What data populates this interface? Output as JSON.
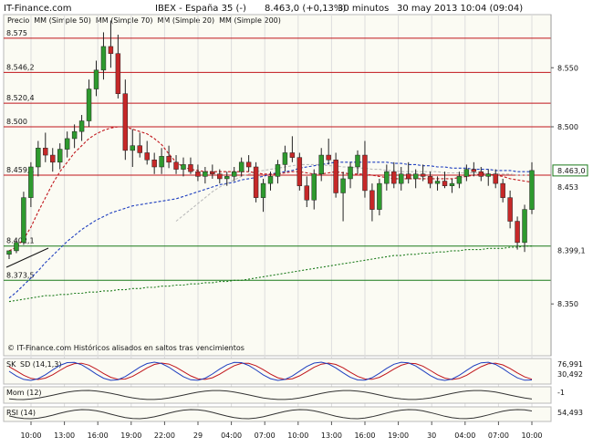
{
  "header": {
    "brand": "IT-Finance.com",
    "instrument": "IBEX - España 35 (-)",
    "quote": "8.463,0 (+0,13%)",
    "interval": "30 minutos",
    "datetime": "30 may 2013 10:04 (09:04)"
  },
  "legend": [
    {
      "text": "Precio",
      "color": "#222222"
    },
    {
      "text": "MM (Simple 50)",
      "color": "#bbbbbb"
    },
    {
      "text": "MM (Simple 70)",
      "color": "#1f3fbf"
    },
    {
      "text": "MM (Simple 20)",
      "color": "#c0151b"
    },
    {
      "text": "MM (Simple 200)",
      "color": "#1a7a1a"
    }
  ],
  "footer_note": "© IT-Finance.com  Históricos alisados en saltos tras vencimientos",
  "chart_data": {
    "type": "candlestick",
    "y_range": [
      8.32,
      8.595
    ],
    "right_ticks": [
      "8.550",
      "8.500",
      "8.350"
    ],
    "right_tick_values": [
      8.55,
      8.5,
      8.35
    ],
    "price_labels": [
      {
        "text": "8.463,0",
        "value": 8.463,
        "color": "#1a7a1a",
        "boxed": true
      },
      {
        "text": "8.453",
        "value": 8.453,
        "color": "#c0151b",
        "boxed": false
      },
      {
        "text": "8.399,1",
        "value": 8.399,
        "color": "#1a7a1a",
        "boxed": false
      }
    ],
    "levels": [
      {
        "text": "8.575",
        "value": 8.575,
        "color": "#c0151b"
      },
      {
        "text": "8.546,2",
        "value": 8.546,
        "color": "#c0151b"
      },
      {
        "text": "8.520,4",
        "value": 8.52,
        "color": "#c0151b"
      },
      {
        "text": "8.500",
        "value": 8.5,
        "color": "#c0151b"
      },
      {
        "text": "8.459,1",
        "value": 8.459,
        "color": "#c0151b"
      },
      {
        "text": "8.402,1",
        "value": 8.399,
        "color": "#1a7a1a"
      },
      {
        "text": "8.373,5",
        "value": 8.37,
        "color": "#1a7a1a"
      }
    ],
    "x_labels": [
      "10:00",
      "13:00",
      "16:00",
      "19:00",
      "22:00",
      "29",
      "04:00",
      "07:00",
      "10:00",
      "13:00",
      "16:00",
      "19:00",
      "30",
      "04:00",
      "07:00",
      "10:00"
    ],
    "candles": [
      [
        8.392,
        8.395,
        8.388,
        8.395
      ],
      [
        8.395,
        8.405,
        8.393,
        8.402
      ],
      [
        8.402,
        8.445,
        8.4,
        8.44
      ],
      [
        8.44,
        8.47,
        8.432,
        8.466
      ],
      [
        8.466,
        8.488,
        8.458,
        8.482
      ],
      [
        8.482,
        8.495,
        8.47,
        8.476
      ],
      [
        8.476,
        8.482,
        8.462,
        8.47
      ],
      [
        8.47,
        8.486,
        8.464,
        8.481
      ],
      [
        8.481,
        8.496,
        8.474,
        8.49
      ],
      [
        8.49,
        8.502,
        8.482,
        8.496
      ],
      [
        8.496,
        8.51,
        8.488,
        8.505
      ],
      [
        8.505,
        8.54,
        8.5,
        8.532
      ],
      [
        8.532,
        8.556,
        8.526,
        8.548
      ],
      [
        8.548,
        8.58,
        8.54,
        8.568
      ],
      [
        8.568,
        8.59,
        8.55,
        8.562
      ],
      [
        8.562,
        8.578,
        8.524,
        8.528
      ],
      [
        8.528,
        8.54,
        8.472,
        8.48
      ],
      [
        8.48,
        8.498,
        8.466,
        8.484
      ],
      [
        8.484,
        8.495,
        8.474,
        8.478
      ],
      [
        8.478,
        8.488,
        8.468,
        8.472
      ],
      [
        8.472,
        8.478,
        8.46,
        8.466
      ],
      [
        8.466,
        8.482,
        8.46,
        8.475
      ],
      [
        8.475,
        8.484,
        8.465,
        8.47
      ],
      [
        8.47,
        8.476,
        8.46,
        8.464
      ],
      [
        8.464,
        8.474,
        8.458,
        8.468
      ],
      [
        8.468,
        8.474,
        8.46,
        8.462
      ],
      [
        8.462,
        8.468,
        8.454,
        8.458
      ],
      [
        8.458,
        8.466,
        8.452,
        8.462
      ],
      [
        8.462,
        8.468,
        8.456,
        8.46
      ],
      [
        8.46,
        8.464,
        8.452,
        8.456
      ],
      [
        8.456,
        8.462,
        8.45,
        8.458
      ],
      [
        8.458,
        8.466,
        8.454,
        8.462
      ],
      [
        8.462,
        8.474,
        8.458,
        8.47
      ],
      [
        8.47,
        8.476,
        8.462,
        8.466
      ],
      [
        8.466,
        8.47,
        8.436,
        8.44
      ],
      [
        8.44,
        8.456,
        8.428,
        8.452
      ],
      [
        8.452,
        8.462,
        8.446,
        8.458
      ],
      [
        8.458,
        8.472,
        8.452,
        8.468
      ],
      [
        8.468,
        8.484,
        8.462,
        8.478
      ],
      [
        8.478,
        8.492,
        8.47,
        8.474
      ],
      [
        8.474,
        8.478,
        8.446,
        8.45
      ],
      [
        8.45,
        8.458,
        8.432,
        8.438
      ],
      [
        8.438,
        8.464,
        8.43,
        8.46
      ],
      [
        8.46,
        8.482,
        8.454,
        8.476
      ],
      [
        8.476,
        8.49,
        8.468,
        8.472
      ],
      [
        8.472,
        8.478,
        8.44,
        8.444
      ],
      [
        8.444,
        8.462,
        8.42,
        8.456
      ],
      [
        8.456,
        8.47,
        8.448,
        8.466
      ],
      [
        8.466,
        8.48,
        8.46,
        8.476
      ],
      [
        8.476,
        8.488,
        8.44,
        8.446
      ],
      [
        8.446,
        8.452,
        8.42,
        8.43
      ],
      [
        8.43,
        8.456,
        8.425,
        8.452
      ],
      [
        8.452,
        8.468,
        8.446,
        8.462
      ],
      [
        8.462,
        8.47,
        8.448,
        8.452
      ],
      [
        8.452,
        8.466,
        8.446,
        8.46
      ],
      [
        8.46,
        8.47,
        8.452,
        8.456
      ],
      [
        8.456,
        8.464,
        8.448,
        8.46
      ],
      [
        8.46,
        8.468,
        8.454,
        8.458
      ],
      [
        8.458,
        8.462,
        8.448,
        8.452
      ],
      [
        8.452,
        8.458,
        8.446,
        8.454
      ],
      [
        8.454,
        8.462,
        8.448,
        8.45
      ],
      [
        8.45,
        8.456,
        8.444,
        8.452
      ],
      [
        8.452,
        8.462,
        8.448,
        8.458
      ],
      [
        8.458,
        8.468,
        8.454,
        8.464
      ],
      [
        8.464,
        8.47,
        8.458,
        8.462
      ],
      [
        8.462,
        8.466,
        8.454,
        8.458
      ],
      [
        8.458,
        8.464,
        8.45,
        8.46
      ],
      [
        8.46,
        8.464,
        8.448,
        8.452
      ],
      [
        8.452,
        8.456,
        8.436,
        8.44
      ],
      [
        8.44,
        8.446,
        8.414,
        8.42
      ],
      [
        8.42,
        8.424,
        8.396,
        8.402
      ],
      [
        8.402,
        8.434,
        8.394,
        8.43
      ],
      [
        8.43,
        8.47,
        8.426,
        8.463
      ]
    ],
    "ma20": [
      8.395,
      8.398,
      8.405,
      8.415,
      8.428,
      8.44,
      8.452,
      8.462,
      8.47,
      8.478,
      8.484,
      8.49,
      8.494,
      8.497,
      8.499,
      8.5,
      8.5,
      8.498,
      8.496,
      8.494,
      8.49,
      8.485,
      8.477,
      8.47,
      8.466,
      8.464,
      8.463,
      8.462,
      8.462,
      8.462,
      8.462,
      8.462,
      8.462,
      8.462,
      8.461,
      8.46,
      8.46,
      8.46,
      8.461,
      8.462,
      8.462,
      8.461,
      8.46,
      8.46,
      8.461,
      8.462,
      8.461,
      8.46,
      8.46,
      8.46,
      8.459,
      8.458,
      8.457,
      8.456,
      8.456,
      8.456,
      8.456,
      8.456,
      8.456,
      8.456,
      8.456,
      8.456,
      8.457,
      8.458,
      8.459,
      8.46,
      8.46,
      8.459,
      8.458,
      8.456,
      8.455,
      8.454,
      8.453
    ],
    "ma50": [
      null,
      null,
      null,
      null,
      null,
      null,
      null,
      null,
      null,
      null,
      null,
      null,
      null,
      null,
      null,
      null,
      null,
      null,
      null,
      null,
      null,
      null,
      null,
      8.42,
      8.425,
      8.43,
      8.435,
      8.44,
      8.445,
      8.449,
      8.452,
      8.455,
      8.458,
      8.46,
      8.462,
      8.463,
      8.464,
      8.465,
      8.466,
      8.467,
      8.468,
      8.468,
      8.468,
      8.468,
      8.467,
      8.467,
      8.466,
      8.466,
      8.465,
      8.465,
      8.464,
      8.464,
      8.463,
      8.463,
      8.462,
      8.462,
      8.462,
      8.462,
      8.462,
      8.462,
      8.461,
      8.461,
      8.461,
      8.461,
      8.461,
      8.461,
      8.46,
      8.46,
      8.46,
      8.46,
      8.459,
      8.459,
      8.459
    ],
    "ma70": [
      8.355,
      8.36,
      8.366,
      8.372,
      8.378,
      8.385,
      8.391,
      8.397,
      8.403,
      8.408,
      8.413,
      8.417,
      8.421,
      8.424,
      8.427,
      8.429,
      8.431,
      8.433,
      8.434,
      8.435,
      8.436,
      8.437,
      8.438,
      8.439,
      8.441,
      8.443,
      8.445,
      8.447,
      8.449,
      8.451,
      8.452,
      8.453,
      8.455,
      8.456,
      8.457,
      8.458,
      8.46,
      8.461,
      8.462,
      8.463,
      8.465,
      8.466,
      8.467,
      8.468,
      8.469,
      8.47,
      8.47,
      8.47,
      8.47,
      8.47,
      8.47,
      8.47,
      8.47,
      8.469,
      8.469,
      8.468,
      8.468,
      8.467,
      8.467,
      8.466,
      8.466,
      8.465,
      8.465,
      8.465,
      8.464,
      8.464,
      8.464,
      8.463,
      8.463,
      8.463,
      8.462,
      8.462,
      8.462
    ],
    "ma200": [
      8.352,
      8.353,
      8.354,
      8.355,
      8.356,
      8.357,
      8.357,
      8.358,
      8.358,
      8.359,
      8.359,
      8.36,
      8.36,
      8.361,
      8.361,
      8.362,
      8.362,
      8.363,
      8.363,
      8.364,
      8.364,
      8.365,
      8.365,
      8.366,
      8.366,
      8.367,
      8.367,
      8.368,
      8.368,
      8.369,
      8.369,
      8.37,
      8.37,
      8.371,
      8.372,
      8.373,
      8.374,
      8.375,
      8.376,
      8.377,
      8.378,
      8.379,
      8.38,
      8.381,
      8.382,
      8.383,
      8.384,
      8.385,
      8.386,
      8.387,
      8.388,
      8.389,
      8.39,
      8.391,
      8.391,
      8.392,
      8.392,
      8.393,
      8.393,
      8.394,
      8.394,
      8.395,
      8.395,
      8.396,
      8.396,
      8.396,
      8.397,
      8.397,
      8.397,
      8.398,
      8.398,
      8.399,
      8.399
    ],
    "indicators": [
      {
        "name": "SK",
        "label_text": "SK",
        "overlay_text": "SD (14,1,3)",
        "values": [
          "76,991",
          "30,492"
        ],
        "value_colors": [
          "#1f3fbf",
          "#c0151b"
        ]
      },
      {
        "name": "Mom (12)",
        "label_text": "Mom (12)",
        "values": [
          "-1"
        ],
        "value_colors": [
          "#111111"
        ]
      },
      {
        "name": "RSI (14)",
        "label_text": "RSI (14)",
        "values": [
          "54,493"
        ],
        "value_colors": [
          "#111111"
        ]
      }
    ]
  }
}
